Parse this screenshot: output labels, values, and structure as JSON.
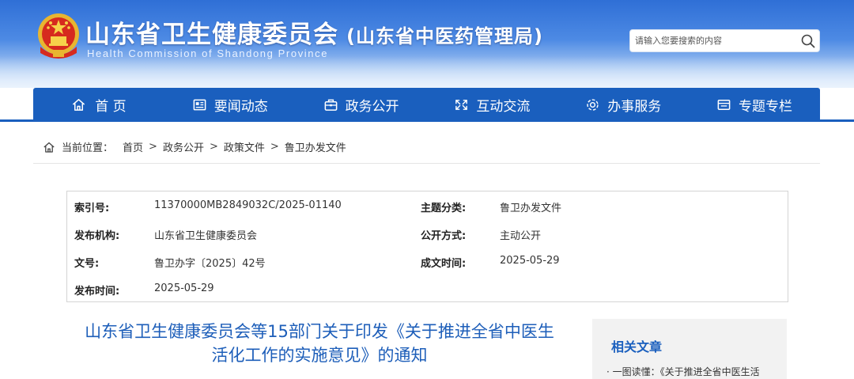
{
  "header": {
    "title": "山东省卫生健康委员会",
    "subtitle": "(山东省中医药管理局)",
    "english": "Health Commission of Shandong Province",
    "search_placeholder": "请输入您要搜索的内容"
  },
  "nav": [
    {
      "label": "首 页",
      "icon": "home-icon"
    },
    {
      "label": "要闻动态",
      "icon": "news-icon"
    },
    {
      "label": "政务公开",
      "icon": "briefcase-icon"
    },
    {
      "label": "互动交流",
      "icon": "interaction-icon"
    },
    {
      "label": "办事服务",
      "icon": "service-icon"
    },
    {
      "label": "专题专栏",
      "icon": "topic-icon"
    }
  ],
  "breadcrumb": {
    "prefix": "当前位置：",
    "items": [
      "首页",
      "政务公开",
      "政策文件",
      "鲁卫办发文件"
    ],
    "separator": ">"
  },
  "meta": {
    "index_label": "索引号:",
    "index_value": "11370000MB2849032C/2025-01140",
    "topic_label": "主题分类:",
    "topic_value": "鲁卫办发文件",
    "issuer_label": "发布机构:",
    "issuer_value": "山东省卫生健康委员会",
    "open_label": "公开方式:",
    "open_value": "主动公开",
    "docno_label": "文号:",
    "docno_value": "鲁卫办字〔2025〕42号",
    "created_label": "成文时间:",
    "created_value": "2025-05-29",
    "published_label": "发布时间:",
    "published_value": "2025-05-29"
  },
  "article": {
    "title_line1": "山东省卫生健康委员会等15部门关于印发《关于推进全省中医生",
    "title_line2": "活化工作的实施意见》的通知"
  },
  "sidebar": {
    "title": "相关文章",
    "items": [
      "· 一图读懂：《关于推进全省中医生活"
    ]
  },
  "colors": {
    "nav_bg": "#1a5fbe",
    "title_blue": "#1d5eb9",
    "header_top": "#2f6fd6"
  }
}
